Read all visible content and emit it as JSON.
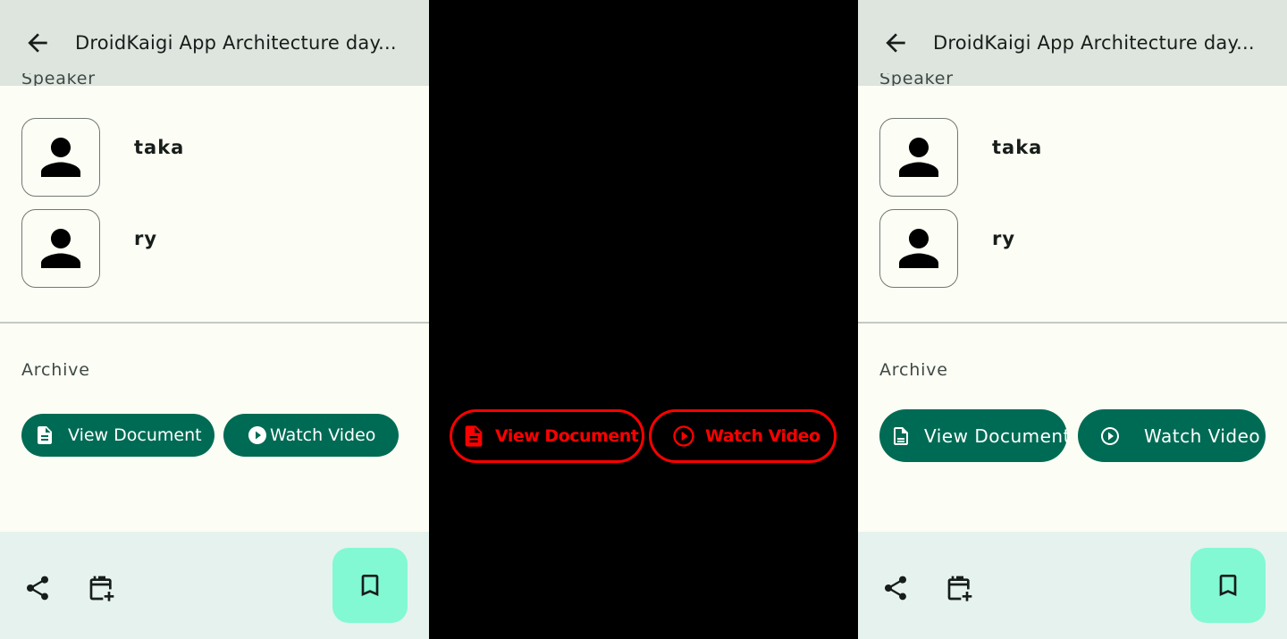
{
  "topbar": {
    "title": "DroidKaigi App Architecture day..."
  },
  "speaker_section": {
    "label": "Speaker",
    "speakers": [
      {
        "name": "taka"
      },
      {
        "name": "ry"
      }
    ]
  },
  "archive_section": {
    "label": "Archive",
    "view_document": "View Document",
    "watch_video": "Watch Video"
  },
  "colors": {
    "topbar": "#dde5de",
    "background": "#fcfdf4",
    "primary": "#006b54",
    "bottombar": "#e5f2ed",
    "fab": "#82f9d3",
    "diff_highlight": "#ff0000"
  },
  "icons": [
    "back-arrow-icon",
    "person-icon",
    "document-icon",
    "play-circle-icon",
    "share-icon",
    "calendar-add-icon",
    "bookmark-icon"
  ]
}
